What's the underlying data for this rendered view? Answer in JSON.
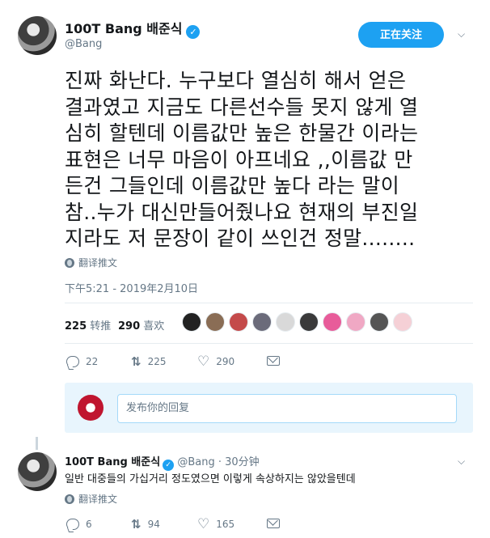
{
  "tweet": {
    "display_name": "100T Bang 배준식",
    "handle": "@Bang",
    "follow_button": "正在关注",
    "text": "진짜 화난다. 누구보다 열심히 해서 얻은\n결과였고 지금도 다른선수들 못지 않게 열\n심히 할텐데 이름값만 높은 한물간 이라는\n표현은 너무 마음이 아프네요 ,,이름값 만\n든건 그들인데 이름값만 높다 라는 말이\n참..누가 대신만들어줬나요 현재의 부진일\n지라도 저 문장이 같이 쓰인건 정말........",
    "translate_label": "翻译推文",
    "timestamp": "下午5:21 - 2019年2月10日",
    "stats": {
      "retweets_count": "225",
      "retweets_label": "转推",
      "likes_count": "290",
      "likes_label": "喜欢"
    },
    "actions": {
      "reply_count": "22",
      "retweet_count": "225",
      "like_count": "290"
    },
    "liker_avatar_colors": [
      "#222222",
      "#8a6d55",
      "#c44a4a",
      "#6b6b7a",
      "#d9d9d9",
      "#3a3a3a",
      "#e85c9a",
      "#f0a8c4",
      "#555555",
      "#f5d0d6"
    ]
  },
  "reply_box": {
    "placeholder": "发布你的回复"
  },
  "reply": {
    "display_name": "100T Bang 배준식",
    "handle_time": "@Bang · 30分钟",
    "text": "일반 대중들의 가십거리 정도였으면 이렇게 속상하지는 않았을텐데",
    "translate_label": "翻译推文",
    "actions": {
      "reply_count": "6",
      "retweet_count": "94",
      "like_count": "165"
    }
  },
  "colors": {
    "accent": "#1da1f2",
    "muted": "#657786",
    "text": "#14171a",
    "divider": "#e6ecf0"
  }
}
